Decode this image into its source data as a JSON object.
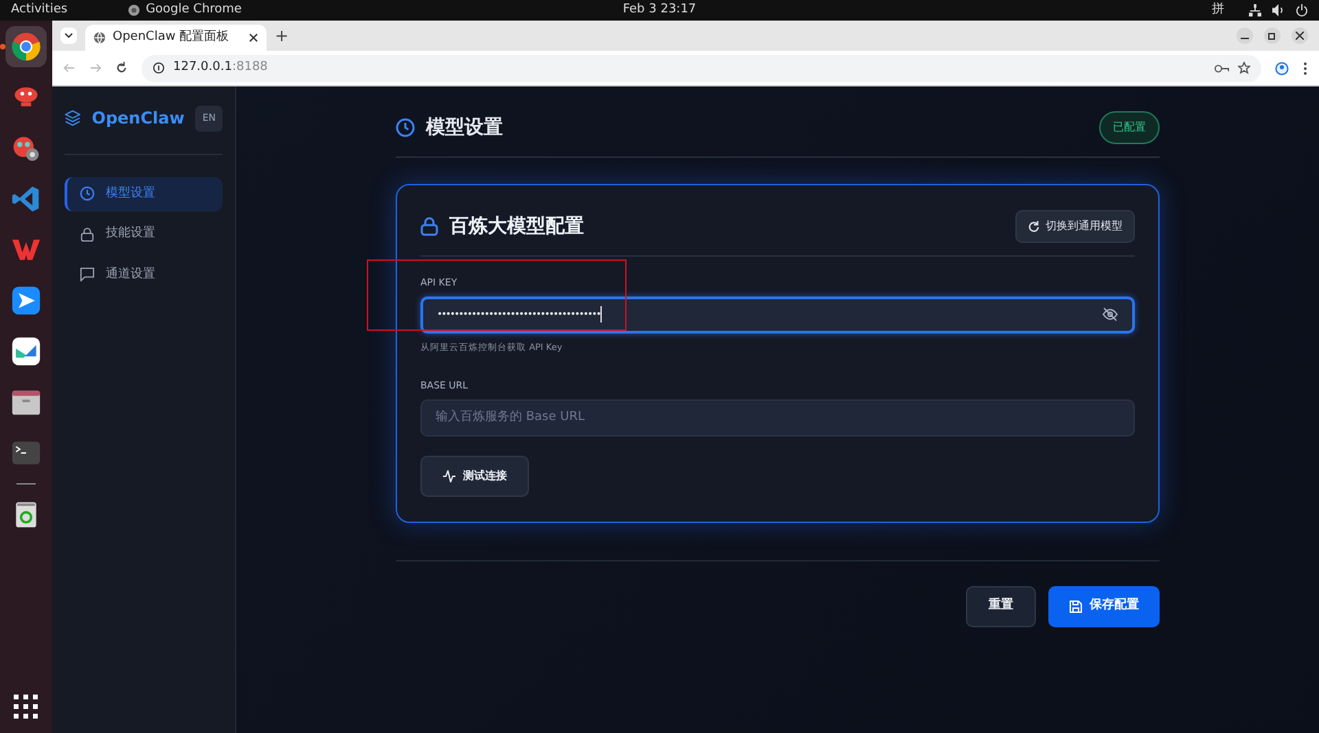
{
  "top_bar": {
    "activities": "Activities",
    "app_name": "Google Chrome",
    "clock": "Feb 3  23:17",
    "input_method": "拼"
  },
  "dock": [
    {
      "active": true
    },
    {
      "active": false
    },
    {
      "active": false
    },
    {
      "active": false
    },
    {
      "active": false
    },
    {
      "active": false
    },
    {
      "active": false
    },
    {
      "active": false
    },
    {
      "active": false
    },
    {
      "active": false
    }
  ],
  "browser": {
    "tab_title": "OpenClaw 配置面板",
    "new_tab": "+",
    "url_host": "127.0.0.1",
    "url_port": ":8188"
  },
  "sidebar": {
    "brand": "OpenClaw",
    "lang_button": "EN",
    "items": [
      {
        "label": "模型设置",
        "selected": true
      },
      {
        "label": "技能设置",
        "selected": false
      },
      {
        "label": "通道设置",
        "selected": false
      }
    ]
  },
  "header": {
    "title": "模型设置",
    "status_badge": "已配置"
  },
  "card": {
    "title": "百炼大模型配置",
    "switch_button": "切换到通用模型",
    "fields": [
      {
        "label": "API KEY",
        "kind": "password",
        "value": "••••••••••••••••••••••••••••••••••••••",
        "focused": true,
        "hint": "从阿里云百炼控制台获取 API Key"
      },
      {
        "label": "BASE URL",
        "kind": "text",
        "placeholder": "输入百炼服务的 Base URL",
        "focused": false
      }
    ],
    "test_button": "测试连接"
  },
  "actions": {
    "reset": "重置",
    "save": "保存配置"
  }
}
